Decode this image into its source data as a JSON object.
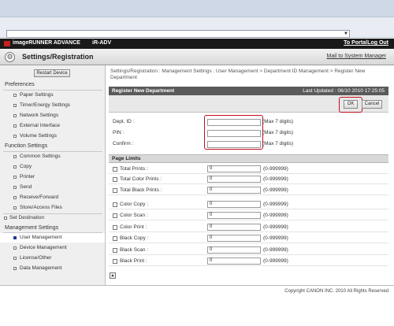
{
  "header": {
    "product": "imageRUNNER ADVANCE",
    "model": "iR-ADV",
    "portal_link": "To Portal",
    "logout_link": "Log Out"
  },
  "titlebar": {
    "title": "Settings/Registration",
    "mail_button": "Mail to System Manager"
  },
  "sidebar": {
    "restart_button": "Restart Device",
    "sections": [
      {
        "heading": "Preferences",
        "items": [
          "Paper Settings",
          "Timer/Energy Settings",
          "Network Settings",
          "External Interface",
          "Volume Settings"
        ]
      },
      {
        "heading": "Function Settings",
        "items": [
          "Common Settings",
          "Copy",
          "Printer",
          "Send",
          "Receive/Forward",
          "Store/Access Files"
        ]
      }
    ],
    "set_destination": "Set Destination",
    "management": {
      "heading": "Management Settings",
      "items": [
        "User Management",
        "Device Management",
        "License/Other",
        "Data Management"
      ],
      "selected": "User Management"
    }
  },
  "main": {
    "breadcrumb": "Settings/Registration : Management Settings : User Management > Department ID Management > Register New Department",
    "panel_title": "Register New Department",
    "last_updated": "Last Updated : 06/10 2010 17:25:05",
    "ok_button": "OK",
    "cancel_button": "Cancel",
    "fields": [
      {
        "label": "Dept. ID :",
        "hint": "(Max 7 digits)",
        "value": ""
      },
      {
        "label": "PIN :",
        "hint": "(Max 7 digits)",
        "value": ""
      },
      {
        "label": "Confirm :",
        "hint": "(Max 7 digits)",
        "value": ""
      }
    ],
    "page_limits_heading": "Page Limits",
    "limits": [
      {
        "label": "Total Prints :",
        "value": "0",
        "range": "(0-999999)"
      },
      {
        "label": "Total Color Prints :",
        "value": "0",
        "range": "(0-999999)"
      },
      {
        "label": "Total Black Prints :",
        "value": "0",
        "range": "(0-999999)"
      },
      {
        "label": "Color Copy :",
        "value": "0",
        "range": "(0-999999)"
      },
      {
        "label": "Color Scan :",
        "value": "0",
        "range": "(0-999999)"
      },
      {
        "label": "Color Print :",
        "value": "0",
        "range": "(0-999999)"
      },
      {
        "label": "Black Copy :",
        "value": "0",
        "range": "(0-999999)"
      },
      {
        "label": "Black Scan :",
        "value": "0",
        "range": "(0-999999)"
      },
      {
        "label": "Black Print :",
        "value": "0",
        "range": "(0-999999)"
      }
    ]
  },
  "footer": {
    "copyright": "Copyright CANON INC. 2010 All Rights Reserved"
  },
  "colors": {
    "highlight_ring": "#c0101a",
    "header_bg": "#1a1a1a",
    "panel_head_bg": "#5a5a5a"
  }
}
